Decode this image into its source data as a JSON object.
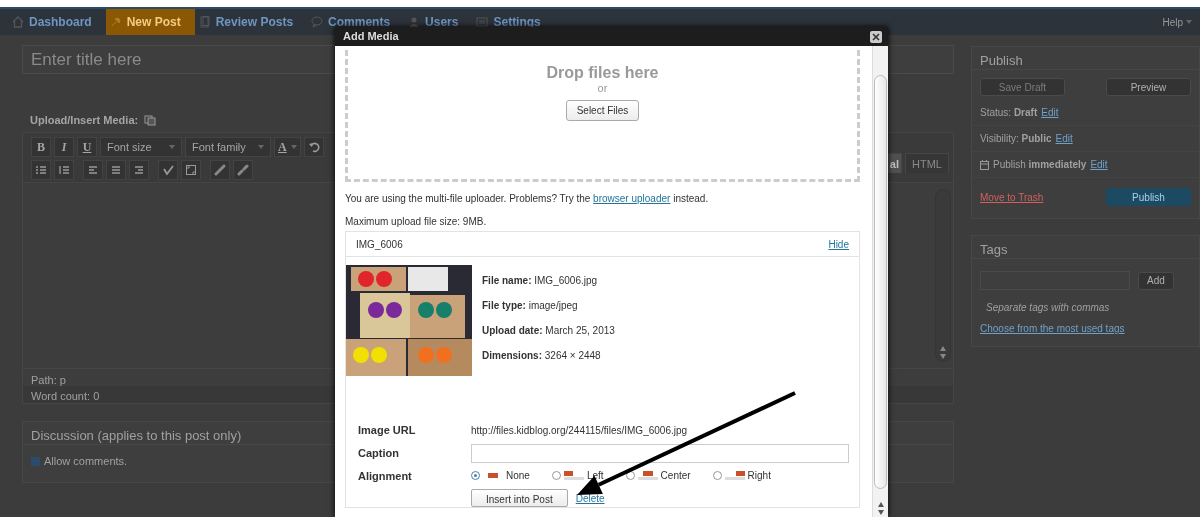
{
  "nav": {
    "items": [
      {
        "label": "Dashboard",
        "kind": "home",
        "selected": false
      },
      {
        "label": "New Post",
        "kind": "pin",
        "selected": true
      },
      {
        "label": "Review Posts",
        "kind": "pages",
        "selected": false
      },
      {
        "label": "Comments",
        "kind": "bubble",
        "selected": false
      },
      {
        "label": "Users",
        "kind": "users",
        "selected": false
      },
      {
        "label": "Settings",
        "kind": "settings",
        "selected": false
      }
    ],
    "help": "Help"
  },
  "editor": {
    "title_placeholder": "Enter title here",
    "media_label": "Upload/Insert Media:",
    "format_buttons": [
      "B",
      "I",
      "U"
    ],
    "font_size": "Font size",
    "font_family": "Font family",
    "color_button": "A",
    "tabs": [
      {
        "label": "al",
        "selected": true
      },
      {
        "label": "HTML",
        "selected": false
      }
    ],
    "path": "Path: p",
    "word_count": "Word count: 0"
  },
  "discussion": {
    "title": "Discussion (applies to this post only)",
    "allow_comments": {
      "label": "Allow comments.",
      "checked": true
    }
  },
  "publish": {
    "title": "Publish",
    "save_draft": {
      "label": "Save Draft",
      "disabled": true
    },
    "preview": "Preview",
    "rows": [
      {
        "kind": "status",
        "text": "Status: **Draft**",
        "link": "Edit"
      },
      {
        "kind": "visibility",
        "text": "Visibility: **Public**",
        "link": "Edit"
      },
      {
        "kind": "schedule",
        "text": "Publish **immediately**",
        "link": "Edit"
      }
    ],
    "trash": "Move to Trash",
    "publish_button": "Publish"
  },
  "tags": {
    "title": "Tags",
    "add": "Add",
    "hint": "Separate tags with commas",
    "link": "Choose from the most used tags"
  },
  "modal": {
    "title": "Add Media",
    "drop_text": "Drop files here",
    "or": "or",
    "select_button": "Select Files",
    "note_before": "You are using the multi-file uploader. Problems? Try the ",
    "note_link": "browser uploader",
    "note_after": " instead.",
    "max_size": "Maximum upload file size: 9MB.",
    "item": {
      "name": "IMG_6006",
      "hide": "Hide",
      "details": [
        "**File name:** IMG_6006.jpg",
        "**File type:** image/jpeg",
        "**Upload date:** March 25, 2013",
        "**Dimensions:** 3264 × 2448"
      ],
      "image_url_label": "Image URL",
      "image_url": "http://files.kidblog.org/244115/files/IMG_6006.jpg",
      "caption_label": "Caption",
      "alignment_label": "Alignment",
      "alignments": [
        {
          "label": "None",
          "kind": "none",
          "selected": true
        },
        {
          "label": "Left",
          "kind": "left",
          "selected": false
        },
        {
          "label": "Center",
          "kind": "center",
          "selected": false
        },
        {
          "label": "Right",
          "kind": "right",
          "selected": false
        }
      ],
      "insert_button": "Insert into Post",
      "delete": "Delete"
    }
  }
}
